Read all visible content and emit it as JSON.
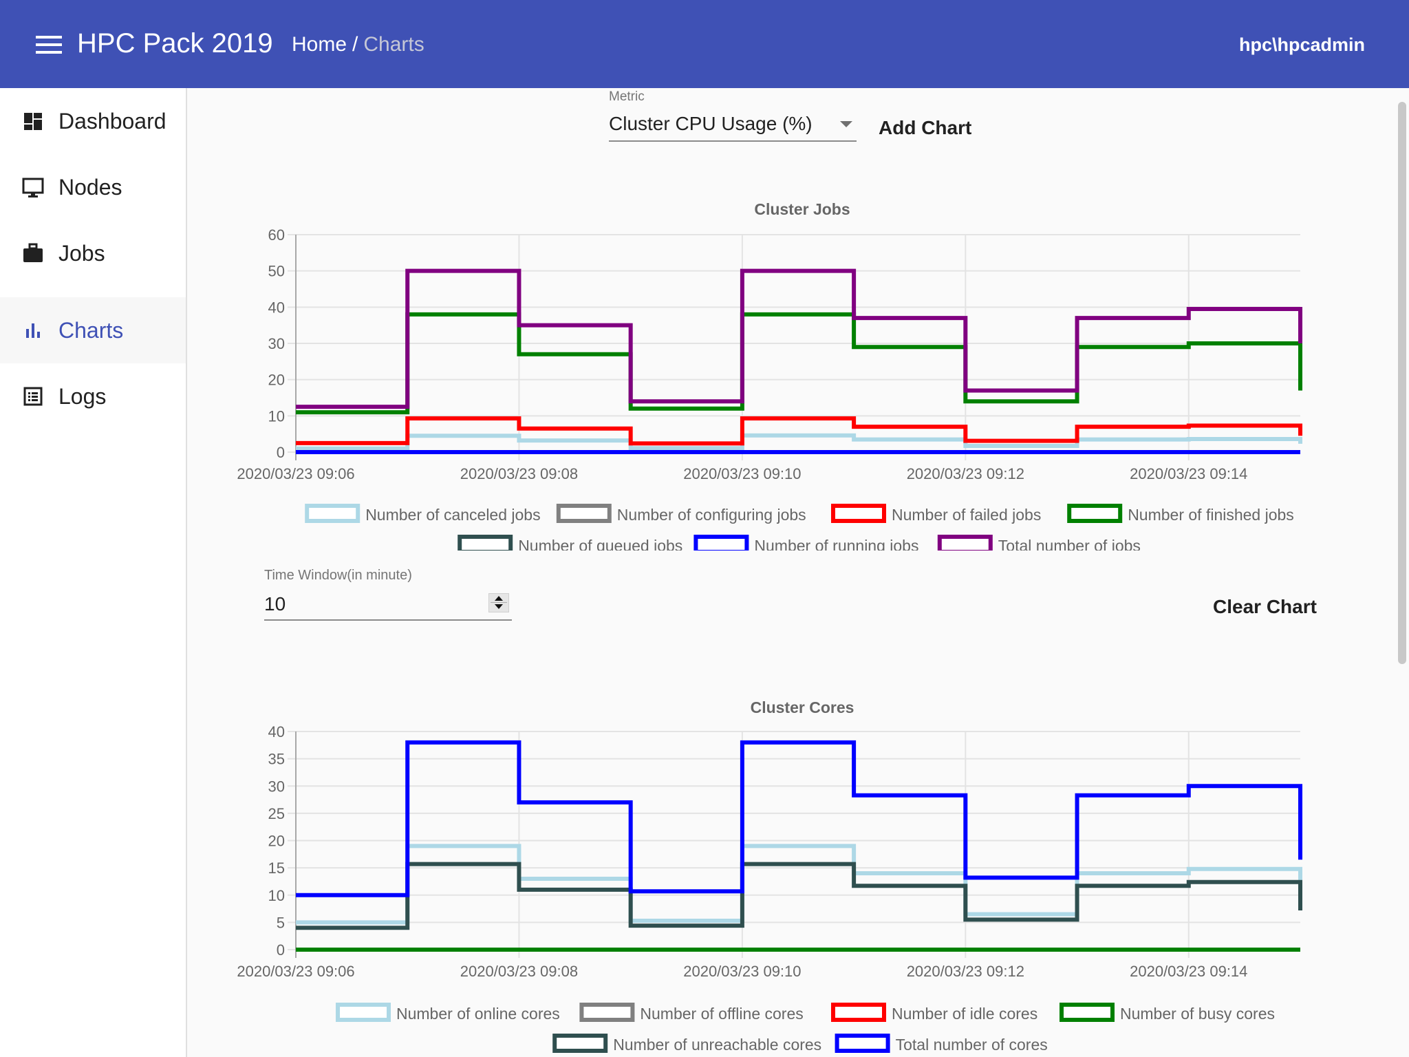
{
  "header": {
    "app_title": "HPC Pack 2019",
    "breadcrumb": {
      "home": "Home",
      "separator": "/",
      "current": "Charts"
    },
    "user": "hpc\\hpcadmin",
    "color": "#3f51b5"
  },
  "sidebar": {
    "items": [
      {
        "label": "Dashboard",
        "icon": "dashboard-icon",
        "active": false
      },
      {
        "label": "Nodes",
        "icon": "monitor-icon",
        "active": false
      },
      {
        "label": "Jobs",
        "icon": "briefcase-icon",
        "active": false
      },
      {
        "label": "Charts",
        "icon": "bar-chart-icon",
        "active": true
      },
      {
        "label": "Logs",
        "icon": "list-icon",
        "active": false
      }
    ]
  },
  "controls": {
    "metric_label": "Metric",
    "metric_value": "Cluster CPU Usage (%)",
    "add_chart": "Add Chart",
    "time_window_label": "Time Window(in minute)",
    "time_window_value": "10",
    "clear_chart": "Clear Chart"
  },
  "chart_data": [
    {
      "type": "line",
      "step": true,
      "title": "Cluster Jobs",
      "xlabel": "",
      "ylabel": "",
      "x": [
        "09:06",
        "09:07",
        "09:08",
        "09:09",
        "09:10",
        "09:11",
        "09:12",
        "09:13",
        "09:14",
        "09:15"
      ],
      "x_ticks": [
        "2020/03/23 09:06",
        "2020/03/23 09:08",
        "2020/03/23 09:10",
        "2020/03/23 09:12",
        "2020/03/23 09:14"
      ],
      "ylim": [
        0,
        60
      ],
      "y_ticks": [
        0,
        10,
        20,
        30,
        40,
        50,
        60
      ],
      "grid": true,
      "legend_position": "bottom",
      "series": [
        {
          "name": "Number of canceled jobs",
          "color": "#add8e6",
          "values": [
            1,
            4.5,
            3.2,
            1.1,
            4.6,
            3.5,
            1.7,
            3.5,
            3.6,
            2.3
          ]
        },
        {
          "name": "Number of configuring jobs",
          "color": "#808080",
          "values": [
            0,
            0,
            0,
            0,
            0,
            0,
            0,
            0,
            0,
            0
          ]
        },
        {
          "name": "Number of failed jobs",
          "color": "#ff0000",
          "values": [
            2.5,
            9.3,
            6.5,
            2.4,
            9.3,
            7,
            3.1,
            7,
            7.3,
            4.5
          ]
        },
        {
          "name": "Number of finished jobs",
          "color": "#008000",
          "values": [
            11,
            38,
            27,
            12,
            38,
            29,
            14,
            29,
            30,
            17
          ]
        },
        {
          "name": "Number of queued jobs",
          "color": "#2f4f4f",
          "values": [
            0,
            0,
            0,
            0,
            0,
            0,
            0,
            0,
            0,
            0
          ]
        },
        {
          "name": "Number of running jobs",
          "color": "#0000ff",
          "values": [
            0,
            0,
            0,
            0,
            0,
            0,
            0,
            0,
            0,
            0
          ]
        },
        {
          "name": "Total number of jobs",
          "color": "#800080",
          "values": [
            12.5,
            50,
            35,
            14,
            50,
            37,
            17,
            37,
            39.5,
            30
          ]
        }
      ]
    },
    {
      "type": "line",
      "step": true,
      "title": "Cluster Cores",
      "xlabel": "",
      "ylabel": "",
      "x": [
        "09:06",
        "09:07",
        "09:08",
        "09:09",
        "09:10",
        "09:11",
        "09:12",
        "09:13",
        "09:14",
        "09:15"
      ],
      "x_ticks": [
        "2020/03/23 09:06",
        "2020/03/23 09:08",
        "2020/03/23 09:10",
        "2020/03/23 09:12",
        "2020/03/23 09:14"
      ],
      "ylim": [
        0,
        40
      ],
      "y_ticks": [
        0,
        5,
        10,
        15,
        20,
        25,
        30,
        35,
        40
      ],
      "grid": true,
      "legend_position": "bottom",
      "series": [
        {
          "name": "Number of online cores",
          "color": "#add8e6",
          "values": [
            5,
            19,
            13,
            5.3,
            19,
            14,
            6.5,
            14,
            14.8,
            7.8
          ]
        },
        {
          "name": "Number of offline cores",
          "color": "#808080",
          "values": [
            0,
            0,
            0,
            0,
            0,
            0,
            0,
            0,
            0,
            0
          ]
        },
        {
          "name": "Number of idle cores",
          "color": "#ff0000",
          "values": [
            0,
            0,
            0,
            0,
            0,
            0,
            0,
            0,
            0,
            0
          ]
        },
        {
          "name": "Number of busy cores",
          "color": "#008000",
          "values": [
            0,
            0,
            0,
            0,
            0,
            0,
            0,
            0,
            0,
            0
          ]
        },
        {
          "name": "Number of unreachable cores",
          "color": "#2f4f4f",
          "values": [
            4,
            15.7,
            11,
            4.4,
            15.7,
            11.7,
            5.5,
            11.7,
            12.4,
            7.2
          ]
        },
        {
          "name": "Total number of cores",
          "color": "#0000ff",
          "values": [
            10,
            38,
            27,
            10.7,
            38,
            28.3,
            13.2,
            28.3,
            30,
            16.5
          ]
        }
      ]
    }
  ]
}
